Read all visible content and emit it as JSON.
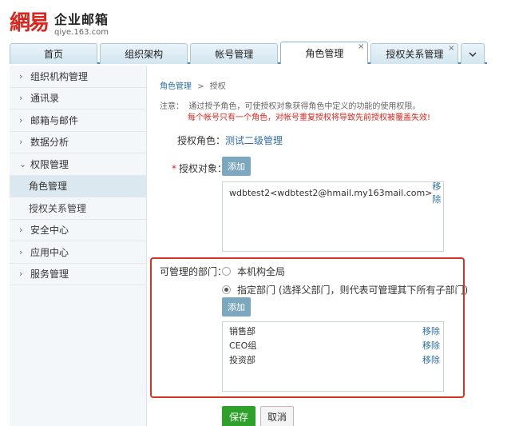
{
  "logo": {
    "mark": "網易",
    "title": "企业邮箱",
    "domain": "qiye.163.com"
  },
  "tabs": [
    {
      "label": "首页",
      "closable": false,
      "active": false
    },
    {
      "label": "组织架构",
      "closable": false,
      "active": false
    },
    {
      "label": "帐号管理",
      "closable": false,
      "active": false
    },
    {
      "label": "角色管理",
      "closable": true,
      "active": true
    },
    {
      "label": "授权关系管理",
      "closable": true,
      "active": false
    }
  ],
  "tab_more_icon": "chevron-down-icon",
  "sidebar": {
    "items": [
      {
        "label": "组织机构管理",
        "chev": "›"
      },
      {
        "label": "通讯录",
        "chev": "›"
      },
      {
        "label": "邮箱与邮件",
        "chev": "›"
      },
      {
        "label": "数据分析",
        "chev": "›"
      },
      {
        "label": "权限管理",
        "chev": "⌄"
      }
    ],
    "subitems": [
      {
        "label": "角色管理",
        "active": true
      },
      {
        "label": "授权关系管理",
        "active": false
      }
    ],
    "items_after": [
      {
        "label": "安全中心",
        "chev": "›"
      },
      {
        "label": "应用中心",
        "chev": "›"
      },
      {
        "label": "服务管理",
        "chev": "›"
      }
    ]
  },
  "breadcrumb": {
    "parent": "角色管理",
    "sep": ">",
    "current": "授权"
  },
  "note": {
    "prefix": "注意：",
    "text": "通过授予角色，可使授权对象获得角色中定义的功能的使用权限。",
    "warning": "每个帐号只有一个角色，对帐号重复授权将导致先前授权被覆盖失效!"
  },
  "role": {
    "label": "授权角色：",
    "value": "测试二级管理"
  },
  "target": {
    "required": "*",
    "label": "授权对象：",
    "add_label": "添加",
    "entries": [
      {
        "name": "wdbtest2<wdbtest2@hmail.my163mail.com>",
        "remove": "移除"
      }
    ]
  },
  "dept": {
    "label": "可管理的部门：",
    "option_all": "本机构全局",
    "option_specific": "指定部门 (选择父部门，则代表可管理其下所有子部门)",
    "selected": "specific",
    "add_label": "添加",
    "entries": [
      {
        "name": "销售部",
        "remove": "移除"
      },
      {
        "name": "CEO组",
        "remove": "移除"
      },
      {
        "name": "投资部",
        "remove": "移除"
      }
    ]
  },
  "actions": {
    "save": "保存",
    "cancel": "取消"
  },
  "colors": {
    "accent": "#4f8fb6",
    "highlight_frame": "#d6331e",
    "save": "#2fa12b",
    "brand": "#d9251c"
  }
}
